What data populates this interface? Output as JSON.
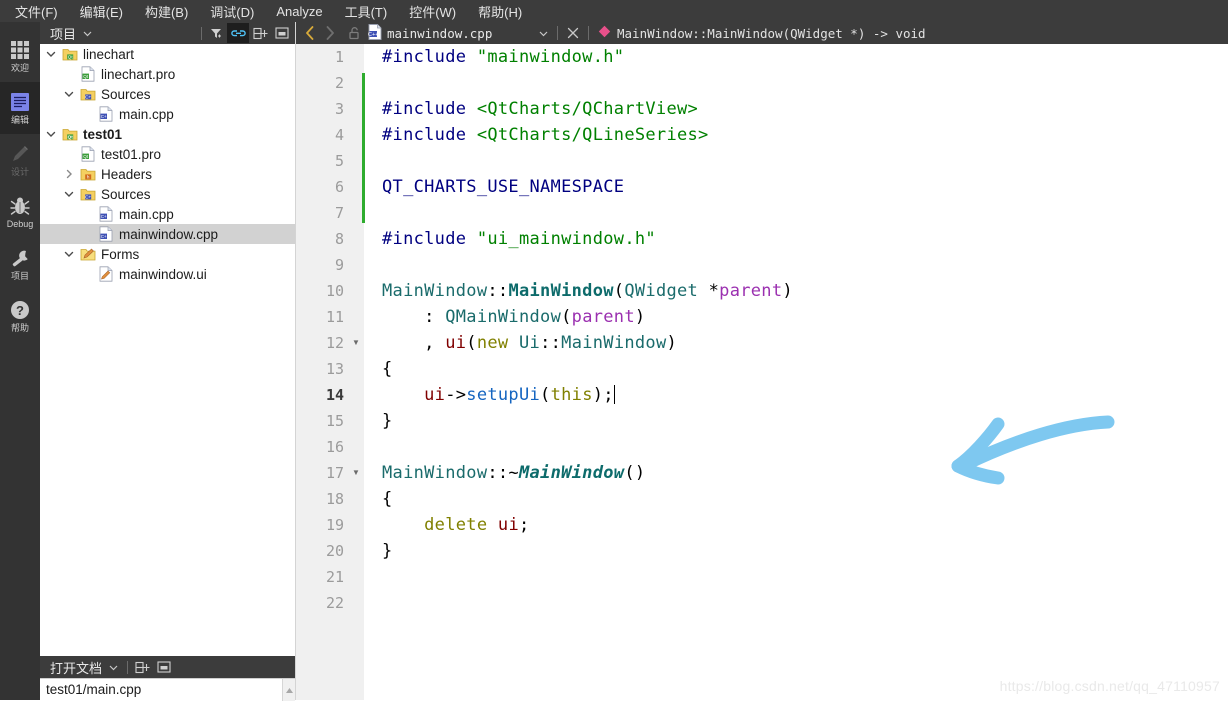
{
  "menu": {
    "items": [
      {
        "label": "文件(F)",
        "name": "menu-file"
      },
      {
        "label": "编辑(E)",
        "name": "menu-edit"
      },
      {
        "label": "构建(B)",
        "name": "menu-build"
      },
      {
        "label": "调试(D)",
        "name": "menu-debug"
      },
      {
        "label": "Analyze",
        "name": "menu-analyze"
      },
      {
        "label": "工具(T)",
        "name": "menu-tools"
      },
      {
        "label": "控件(W)",
        "name": "menu-window"
      },
      {
        "label": "帮助(H)",
        "name": "menu-help"
      }
    ]
  },
  "modebar": {
    "items": [
      {
        "label": "欢迎",
        "icon": "grid-icon",
        "active": false,
        "disabled": false
      },
      {
        "label": "编辑",
        "icon": "edit-document-icon",
        "active": true,
        "disabled": false
      },
      {
        "label": "设计",
        "icon": "pencil-icon",
        "active": false,
        "disabled": true
      },
      {
        "label": "Debug",
        "icon": "bug-icon",
        "active": false,
        "disabled": false
      },
      {
        "label": "项目",
        "icon": "wrench-icon",
        "active": false,
        "disabled": false
      },
      {
        "label": "帮助",
        "icon": "question-mark-icon",
        "active": false,
        "disabled": false
      }
    ]
  },
  "project_panel": {
    "title": "项目",
    "toolbar": [
      {
        "name": "filter-icon",
        "label": "Filter"
      },
      {
        "name": "link-icon",
        "label": "Synchronize with Editor",
        "active": true
      },
      {
        "name": "split-icon",
        "label": "Split"
      },
      {
        "name": "close-panel-icon",
        "label": "Close"
      }
    ],
    "tree": [
      {
        "depth": 0,
        "label": "linechart",
        "icon": "qt-folder-icon",
        "expander": "down",
        "bold": false,
        "selected": false
      },
      {
        "depth": 1,
        "label": "linechart.pro",
        "icon": "qt-file-icon",
        "expander": "none",
        "bold": false,
        "selected": false
      },
      {
        "depth": 1,
        "label": "Sources",
        "icon": "cpp-folder-icon",
        "expander": "down",
        "bold": false,
        "selected": false
      },
      {
        "depth": 2,
        "label": "main.cpp",
        "icon": "cpp-file-icon",
        "expander": "none",
        "bold": false,
        "selected": false
      },
      {
        "depth": 0,
        "label": "test01",
        "icon": "qt-folder-icon",
        "expander": "down",
        "bold": true,
        "selected": false
      },
      {
        "depth": 1,
        "label": "test01.pro",
        "icon": "qt-file-icon",
        "expander": "none",
        "bold": false,
        "selected": false
      },
      {
        "depth": 1,
        "label": "Headers",
        "icon": "h-folder-icon",
        "expander": "right",
        "bold": false,
        "selected": false
      },
      {
        "depth": 1,
        "label": "Sources",
        "icon": "cpp-folder-icon",
        "expander": "down",
        "bold": false,
        "selected": false
      },
      {
        "depth": 2,
        "label": "main.cpp",
        "icon": "cpp-file-icon",
        "expander": "none",
        "bold": false,
        "selected": false
      },
      {
        "depth": 2,
        "label": "mainwindow.cpp",
        "icon": "cpp-file-icon",
        "expander": "none",
        "bold": false,
        "selected": true
      },
      {
        "depth": 1,
        "label": "Forms",
        "icon": "ui-folder-icon",
        "expander": "down",
        "bold": false,
        "selected": false
      },
      {
        "depth": 2,
        "label": "mainwindow.ui",
        "icon": "ui-file-icon",
        "expander": "none",
        "bold": false,
        "selected": false
      }
    ]
  },
  "open_documents": {
    "title": "打开文档",
    "toolbar": [
      {
        "name": "split-icon",
        "label": "Split"
      },
      {
        "name": "close-panel-icon",
        "label": "Close"
      }
    ],
    "items": [
      {
        "label": "test01/main.cpp"
      }
    ]
  },
  "editor_toolbar": {
    "back_label": "‹",
    "forward_label": "›",
    "lock_label": "unlocked",
    "file_icon": "cpp-file-icon",
    "file_name": "mainwindow.cpp",
    "close_label": "✕",
    "symbol_icon": "class-member-diamond-icon",
    "symbol_text": "MainWindow::MainWindow(QWidget *) -> void"
  },
  "code": {
    "current_line": 14,
    "change_bar_lines": [
      2,
      7
    ],
    "fold_lines": [
      12,
      17
    ],
    "lines": [
      {
        "n": 1,
        "tokens": [
          {
            "t": "#include ",
            "c": "k-pre"
          },
          {
            "t": "\"mainwindow.h\"",
            "c": "k-str"
          }
        ]
      },
      {
        "n": 2,
        "tokens": []
      },
      {
        "n": 3,
        "tokens": [
          {
            "t": "#include ",
            "c": "k-pre"
          },
          {
            "t": "<QtCharts/QChartView>",
            "c": "k-str"
          }
        ]
      },
      {
        "n": 4,
        "tokens": [
          {
            "t": "#include ",
            "c": "k-pre"
          },
          {
            "t": "<QtCharts/QLineSeries>",
            "c": "k-str"
          }
        ]
      },
      {
        "n": 5,
        "tokens": []
      },
      {
        "n": 6,
        "tokens": [
          {
            "t": "QT_CHARTS_USE_NAMESPACE",
            "c": "k-macro"
          }
        ]
      },
      {
        "n": 7,
        "tokens": []
      },
      {
        "n": 8,
        "tokens": [
          {
            "t": "#include ",
            "c": "k-pre"
          },
          {
            "t": "\"ui_mainwindow.h\"",
            "c": "k-str"
          }
        ]
      },
      {
        "n": 9,
        "tokens": []
      },
      {
        "n": 10,
        "tokens": [
          {
            "t": "MainWindow",
            "c": "k-type"
          },
          {
            "t": "::",
            "c": "k-plain"
          },
          {
            "t": "MainWindow",
            "c": "k-decl"
          },
          {
            "t": "(",
            "c": "k-plain"
          },
          {
            "t": "QWidget",
            "c": "k-type"
          },
          {
            "t": " *",
            "c": "k-plain"
          },
          {
            "t": "parent",
            "c": "k-arg"
          },
          {
            "t": ")",
            "c": "k-plain"
          }
        ]
      },
      {
        "n": 11,
        "tokens": [
          {
            "t": "    : ",
            "c": "k-plain"
          },
          {
            "t": "QMainWindow",
            "c": "k-type"
          },
          {
            "t": "(",
            "c": "k-plain"
          },
          {
            "t": "parent",
            "c": "k-arg"
          },
          {
            "t": ")",
            "c": "k-plain"
          }
        ]
      },
      {
        "n": 12,
        "tokens": [
          {
            "t": "    , ",
            "c": "k-plain"
          },
          {
            "t": "ui",
            "c": "k-fld"
          },
          {
            "t": "(",
            "c": "k-plain"
          },
          {
            "t": "new",
            "c": "k-kw"
          },
          {
            "t": " ",
            "c": "k-plain"
          },
          {
            "t": "Ui",
            "c": "k-type"
          },
          {
            "t": "::",
            "c": "k-plain"
          },
          {
            "t": "MainWindow",
            "c": "k-type"
          },
          {
            "t": ")",
            "c": "k-plain"
          }
        ]
      },
      {
        "n": 13,
        "tokens": [
          {
            "t": "{",
            "c": "k-plain"
          }
        ]
      },
      {
        "n": 14,
        "tokens": [
          {
            "t": "    ",
            "c": "k-plain"
          },
          {
            "t": "ui",
            "c": "k-fld"
          },
          {
            "t": "->",
            "c": "k-plain"
          },
          {
            "t": "setupUi",
            "c": "k-fn"
          },
          {
            "t": "(",
            "c": "k-plain"
          },
          {
            "t": "this",
            "c": "k-kw"
          },
          {
            "t": ");",
            "c": "k-plain"
          }
        ],
        "caret": true
      },
      {
        "n": 15,
        "tokens": [
          {
            "t": "}",
            "c": "k-plain"
          }
        ]
      },
      {
        "n": 16,
        "tokens": []
      },
      {
        "n": 17,
        "tokens": [
          {
            "t": "MainWindow",
            "c": "k-type"
          },
          {
            "t": "::~",
            "c": "k-plain"
          },
          {
            "t": "MainWindow",
            "c": "k-dtor"
          },
          {
            "t": "()",
            "c": "k-plain"
          }
        ]
      },
      {
        "n": 18,
        "tokens": [
          {
            "t": "{",
            "c": "k-plain"
          }
        ]
      },
      {
        "n": 19,
        "tokens": [
          {
            "t": "    ",
            "c": "k-plain"
          },
          {
            "t": "delete",
            "c": "k-kw"
          },
          {
            "t": " ",
            "c": "k-plain"
          },
          {
            "t": "ui",
            "c": "k-fld"
          },
          {
            "t": ";",
            "c": "k-plain"
          }
        ]
      },
      {
        "n": 20,
        "tokens": [
          {
            "t": "}",
            "c": "k-plain"
          }
        ]
      },
      {
        "n": 21,
        "tokens": []
      },
      {
        "n": 22,
        "tokens": []
      }
    ]
  },
  "annotation": {
    "shape": "curved-arrow",
    "color": "#7ec8f0",
    "points_to": "end of line 14"
  },
  "watermark": {
    "text": "https://blog.csdn.net/qq_47110957"
  },
  "colors": {
    "chrome": "#3c3c3c",
    "modebar": "#333333",
    "mode_active": "#262626",
    "editor_bg": "#ffffff",
    "gutter_bg": "#f0f0f0",
    "selection": "#d2d2d2",
    "change_bar": "#2eac2e",
    "accent_yellow": "#d9ab3a",
    "annotation": "#7ec8f0"
  }
}
